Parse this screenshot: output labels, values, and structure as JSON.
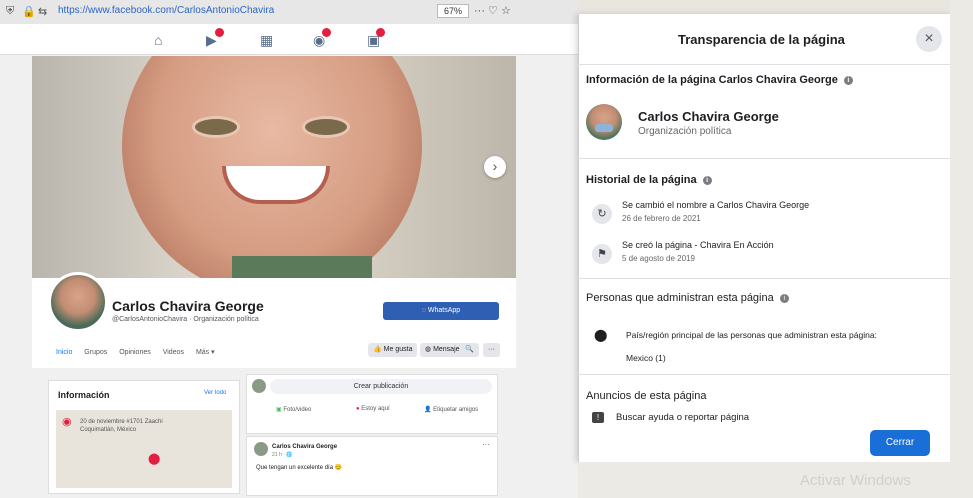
{
  "browser": {
    "url": "https://www.facebook.com/CarlosAntonioChavira",
    "zoom": "67%",
    "tools": "··· ♡ ☆"
  },
  "profile": {
    "name": "Carlos Chavira George",
    "subtitle": "@CarlosAntonioChavira · Organización política",
    "whatsapp_label": "WhatsApp",
    "tabs": [
      "Inicio",
      "Grupos",
      "Opiniones",
      "Videos",
      "Más ▾"
    ],
    "actions": {
      "like": "Me gusta",
      "message": "Mensaje",
      "search": "🔍",
      "more": "···"
    }
  },
  "info": {
    "title": "Información",
    "see_all": "Ver todo",
    "address_line1": "20 de noviembre #1701 Zaachi",
    "address_line2": "Coquimatlán, México"
  },
  "post": {
    "placeholder": "Crear publicación",
    "photo": "Foto/video",
    "location": "Estoy aquí",
    "tag": "Etiquetar amigos"
  },
  "feed": {
    "author": "Carlos Chavira George",
    "time": "21 h · 🌐",
    "text": "Que tengan un excelente día 😊"
  },
  "dialog": {
    "title": "Transparencia de la página",
    "info_heading": "Información de la página Carlos Chavira George",
    "page_name": "Carlos Chavira George",
    "page_category": "Organización política",
    "history_heading": "Historial de la página",
    "history": [
      {
        "text": "Se cambió el nombre a Carlos Chavira George",
        "date": "26 de febrero de 2021"
      },
      {
        "text": "Se creó la página - Chavira En Acción",
        "date": "5 de agosto de 2019"
      }
    ],
    "admins_heading": "Personas que administran esta página",
    "admins_text": "País/región principal de las personas que administran esta página:",
    "admins_country": "Mexico (1)",
    "ads_heading": "Anuncios de esta página",
    "ads_link": "Buscar ayuda o reportar página",
    "close_button": "Cerrar"
  },
  "watermark": "Activar Windows",
  "colors": {
    "accent": "#1a6ed8",
    "fb_blue": "#1877f2"
  }
}
